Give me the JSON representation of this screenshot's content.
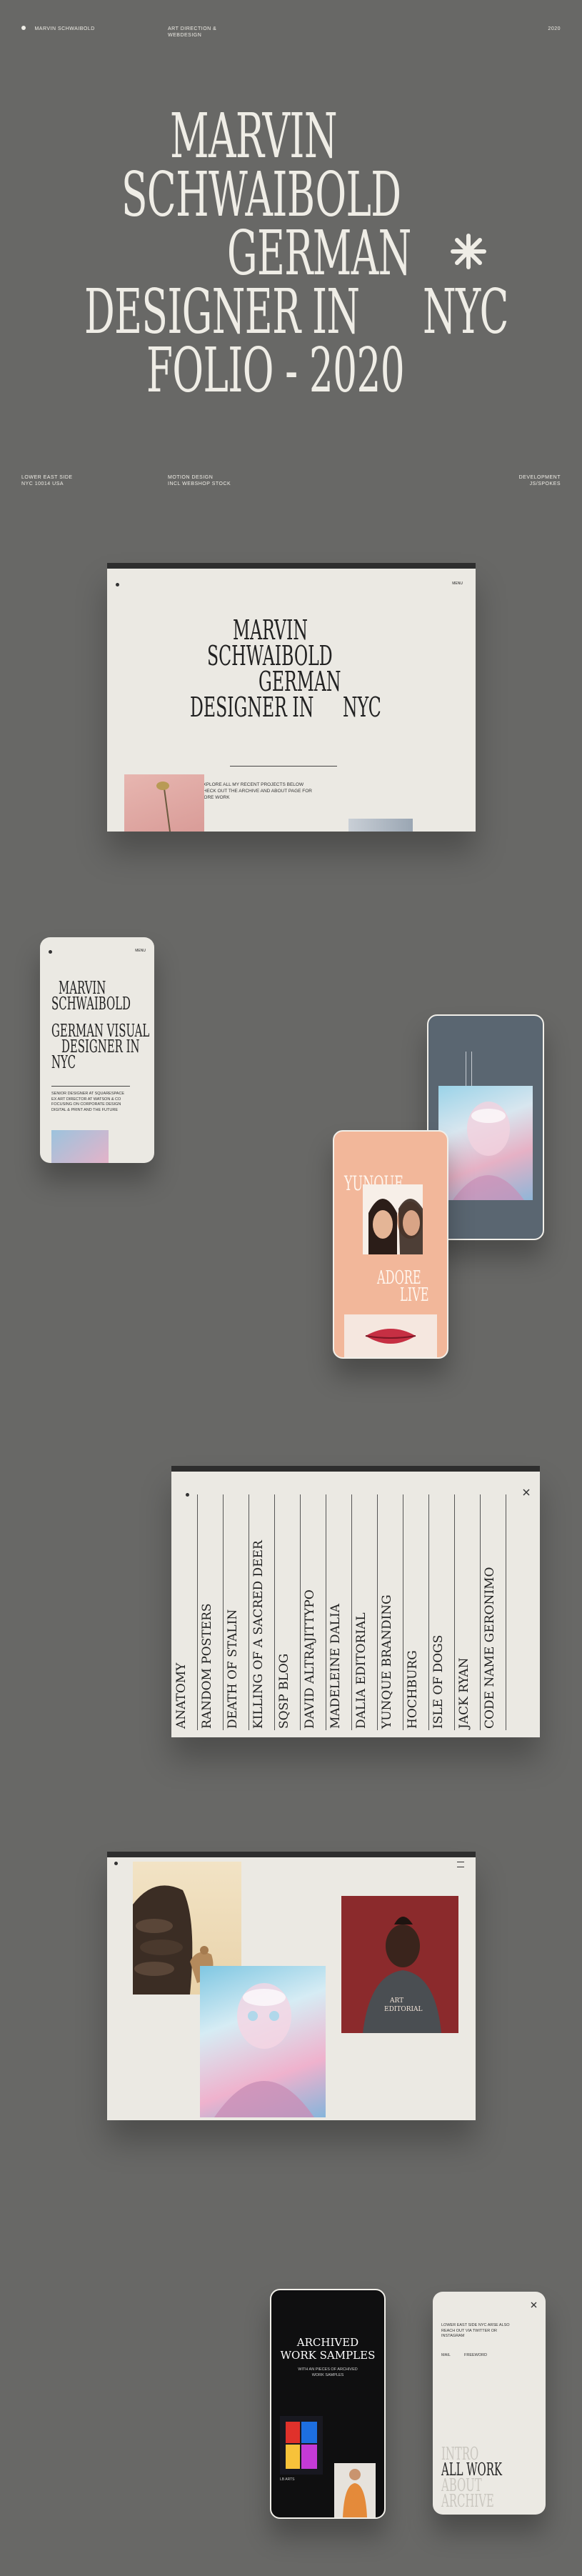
{
  "header": {
    "brand": "MARVIN SCHWAIBOLD",
    "role_line1": "ART DIRECTION &",
    "role_line2": "WEBDESIGN",
    "year": "2020"
  },
  "hero": {
    "line1": "MARVIN",
    "line2": "SCHWAIBOLD",
    "line3": "GERMAN",
    "line4a": "DESIGNER IN",
    "line4b": "NYC",
    "line5": "FOLIO - 2020"
  },
  "info": {
    "left1": "LOWER EAST SIDE",
    "left2": "NYC 10014 USA",
    "mid1": "MOTION DESIGN",
    "mid2": "INCL WEBSHOP STOCK",
    "right1": "DEVELOPMENT",
    "right2": "JS/SPOKES"
  },
  "desktop1": {
    "menu": "MENU",
    "line1": "MARVIN",
    "line2": "SCHWAIBOLD",
    "line3": "GERMAN",
    "line4a": "DESIGNER IN",
    "line4b": "NYC",
    "desc": "EXPLORE ALL MY RECENT PROJECTS BELOW CHECK OUT THE ARCHIVE AND ABOUT PAGE FOR MORE WORK"
  },
  "phone_left": {
    "menu": "MENU",
    "line1": "MARVIN",
    "line2": "SCHWAIBOLD",
    "line3": "GERMAN VISUAL",
    "line4": "DESIGNER IN",
    "line5": "NYC",
    "bio": "SENIOR DESIGNER AT SQUARESPACE EX ART DIRECTOR AT WATSON & CO FOCUSING ON CORPORATE DESIGN DIGITAL & PRINT AND THE FUTURE"
  },
  "phone_peach": {
    "title": "YUNQUE",
    "adore": "ADORE",
    "live": "LIVE"
  },
  "project_list": {
    "items": [
      "ANATOMY",
      "RANDOM POSTERS",
      "DEATH OF STALIN",
      "KILLING OF A SACRED DEER",
      "SQSP BLOG",
      "DAVID ALTRAJITTYPO",
      "MADELEINE DALIA",
      "DALIA EDITORIAL",
      "YUNQUE BRANDING",
      "HOCHBURG",
      "ISLE OF DOGS",
      "JACK RYAN",
      "CODE NAME GERONIMO"
    ]
  },
  "desktop3": {
    "portrait_caption1": "ART",
    "portrait_caption2": "EDITORIAL"
  },
  "phone_archive": {
    "title1": "ARCHIVED",
    "title2": "WORK SAMPLES",
    "sub": "WITH AN PIECES OF ARCHIVED WORK SAMPLES",
    "caption": "LB ARTS"
  },
  "phone_menu": {
    "blurb": "LOWER EAST SIDE NYC ARSE ALSO REACH OUT VIA TWITTER OR INSTAGRAM",
    "link1": "MAIL",
    "link2": "FREEWORD",
    "nav1": "INTRO",
    "nav2": "ALL WORK",
    "nav3": "ABOUT",
    "nav4": "ARCHIVE"
  },
  "colors": {
    "background": "#686866",
    "paper": "#ebe9e3",
    "pink": "#e3aaa6",
    "peach": "#f2b79a",
    "slate": "#5a6671"
  }
}
